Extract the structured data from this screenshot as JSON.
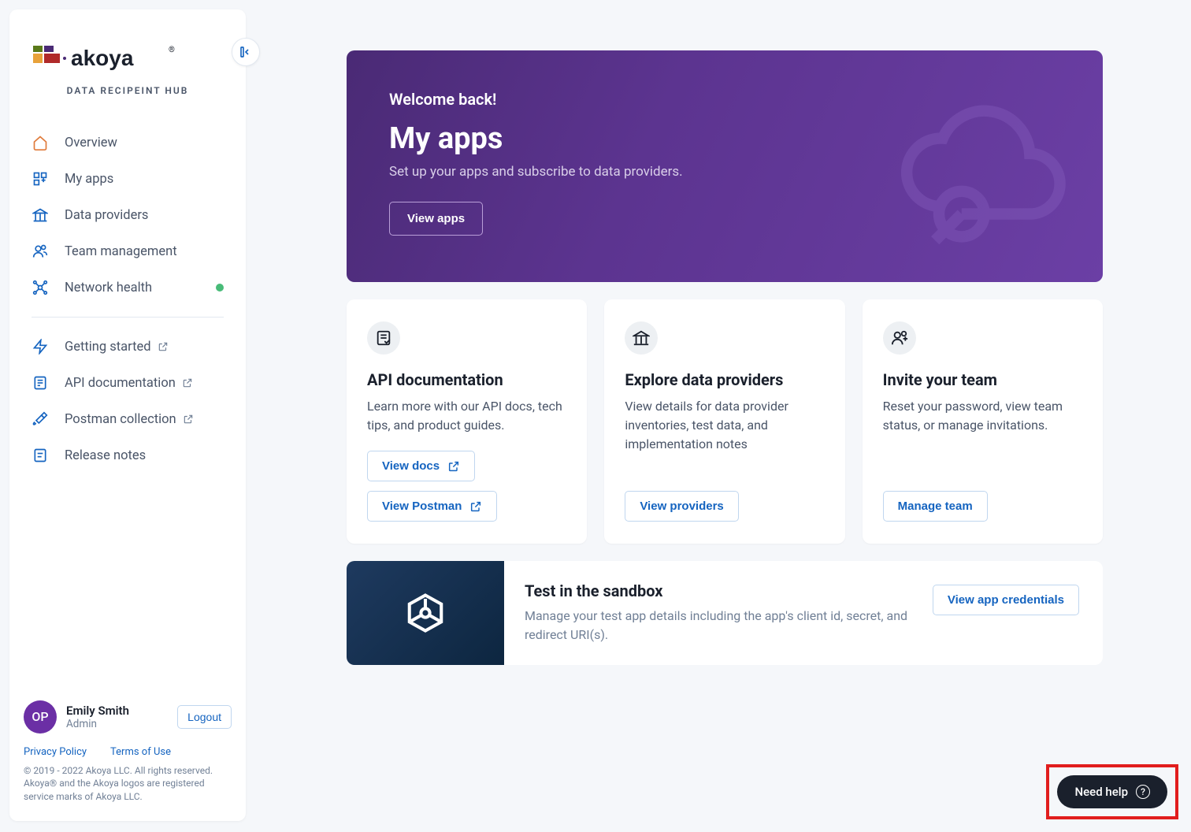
{
  "brand": {
    "name": "akoya",
    "tagline": "DATA RECIPEINT HUB"
  },
  "sidebar": {
    "items": [
      {
        "label": "Overview"
      },
      {
        "label": "My apps"
      },
      {
        "label": "Data providers"
      },
      {
        "label": "Team management"
      },
      {
        "label": "Network health"
      }
    ],
    "secondary": [
      {
        "label": "Getting started"
      },
      {
        "label": "API documentation"
      },
      {
        "label": "Postman collection"
      },
      {
        "label": "Release notes"
      }
    ]
  },
  "user": {
    "initials": "OP",
    "name": "Emily Smith",
    "role": "Admin",
    "logout_label": "Logout"
  },
  "footer": {
    "privacy": "Privacy Policy",
    "terms": "Terms of Use",
    "copyright": "© 2019 - 2022 Akoya LLC. All rights reserved. Akoya® and the Akoya logos are registered service marks of Akoya LLC."
  },
  "hero": {
    "welcome": "Welcome back!",
    "title": "My apps",
    "subtitle": "Set up your apps and subscribe to data providers.",
    "cta": "View apps"
  },
  "cards": [
    {
      "title": "API documentation",
      "desc": "Learn more with our API docs, tech tips, and product guides.",
      "actions": [
        "View docs",
        "View Postman"
      ]
    },
    {
      "title": "Explore data providers",
      "desc": "View details for data provider inventories, test data, and implementation notes",
      "actions": [
        "View providers"
      ]
    },
    {
      "title": "Invite your team",
      "desc": "Reset your password, view team status, or manage invitations.",
      "actions": [
        "Manage team"
      ]
    }
  ],
  "sandbox": {
    "title": "Test in the sandbox",
    "desc": "Manage your test app details including the app's client id, secret, and redirect URI(s).",
    "cta": "View app credentials"
  },
  "help": {
    "label": "Need help"
  }
}
